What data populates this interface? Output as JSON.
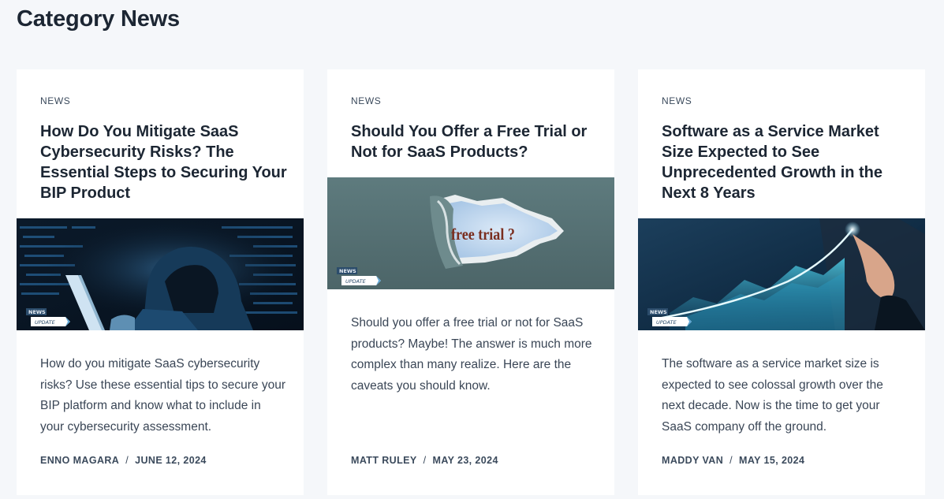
{
  "page": {
    "title": "Category News"
  },
  "badge": {
    "top": "NEWS",
    "bottom": "UPDATE"
  },
  "thumbs": {
    "free_trial_text": "free trial ?"
  },
  "cards": [
    {
      "category": "NEWS",
      "title": "How Do You Mitigate SaaS Cybersecurity Risks? The Essential Steps to Securing Your BIP Product",
      "excerpt": "How do you mitigate SaaS cybersecurity risks? Use these essential tips to secure your BIP platform and know what to include in your cybersecurity assessment.",
      "author": "ENNO MAGARA",
      "date": "JUNE 12, 2024",
      "separator": "/"
    },
    {
      "category": "NEWS",
      "title": "Should You Offer a Free Trial or Not for SaaS Products?",
      "excerpt": "Should you offer a free trial or not for SaaS products? Maybe! The answer is much more complex than many realize. Here are the caveats you should know.",
      "author": "MATT RULEY",
      "date": "MAY 23, 2024",
      "separator": "/"
    },
    {
      "category": "NEWS",
      "title": "Software as a Service Market Size Expected to See Unprecedented Growth in the Next 8 Years",
      "excerpt": "The software as a service market size is expected to see colossal growth over the next decade. Now is the time to get your SaaS company off the ground.",
      "author": "MADDY VAN",
      "date": "MAY 15, 2024",
      "separator": "/"
    }
  ]
}
